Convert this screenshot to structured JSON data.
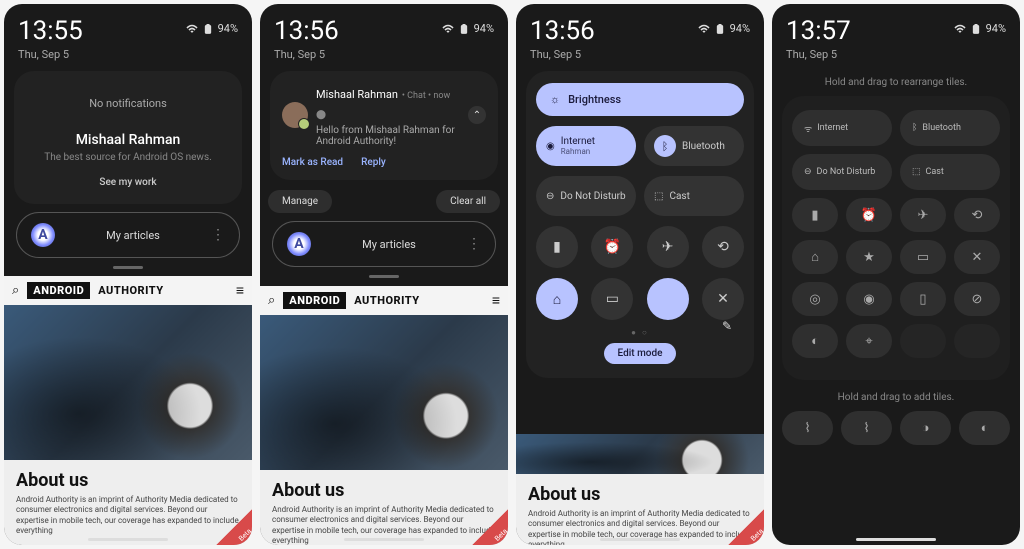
{
  "status": {
    "battery": "94%",
    "date": "Thu, Sep 5"
  },
  "screens": [
    {
      "time": "13:55"
    },
    {
      "time": "13:56"
    },
    {
      "time": "13:56"
    },
    {
      "time": "13:57"
    }
  ],
  "s1": {
    "no_notif": "No notifications",
    "author": "Mishaal Rahman",
    "tagline": "The best source for Android OS news.",
    "seemywork": "See my work",
    "myarticles": "My articles"
  },
  "s2": {
    "notif": {
      "name": "Mishaal Rahman",
      "app": "Chat",
      "when": "now",
      "body": "Hello from Mishaal Rahman for Android Authority!",
      "mark_read": "Mark as Read",
      "reply": "Reply"
    },
    "manage": "Manage",
    "clearall": "Clear all",
    "myarticles": "My articles"
  },
  "s3": {
    "brightness": "Brightness",
    "internet": {
      "label": "Internet",
      "sub": "Rahman"
    },
    "bluetooth": "Bluetooth",
    "dnd": "Do Not Disturb",
    "cast": "Cast",
    "editmode": "Edit mode"
  },
  "s4": {
    "hint_top": "Hold and drag to rearrange tiles.",
    "hint_bottom": "Hold and drag to add tiles.",
    "internet": "Internet",
    "bluetooth": "Bluetooth",
    "dnd": "Do Not Disturb",
    "cast": "Cast"
  },
  "browser": {
    "logo_boxed": "ANDROID",
    "logo_after": "AUTHORITY",
    "about_h": "About us",
    "about_body": "Android Authority is an imprint of Authority Media dedicated to consumer electronics and digital services. Beyond our expertise in mobile tech, our coverage has expanded to include everything"
  }
}
